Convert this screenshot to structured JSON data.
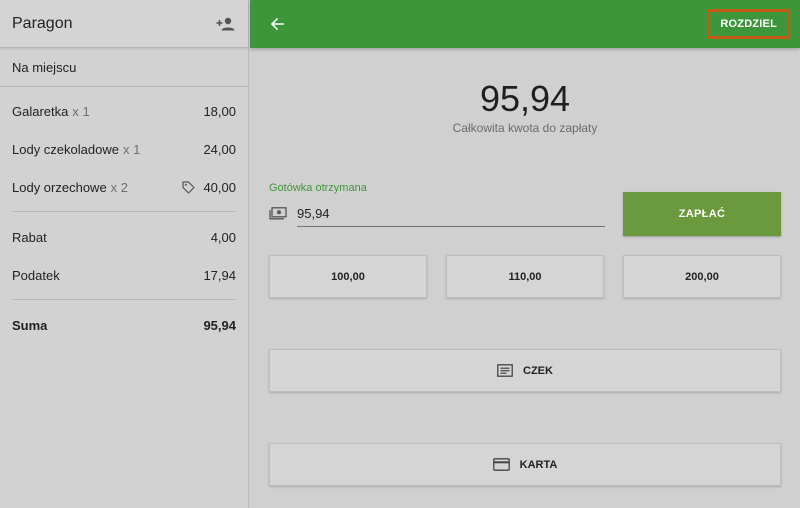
{
  "receipt": {
    "title": "Paragon",
    "add_customer_icon": "person-add-icon",
    "dine_option": "Na miejscu",
    "items": [
      {
        "name": "Galaretka",
        "qty": "x 1",
        "amount": "18,00",
        "has_tag": false
      },
      {
        "name": "Lody czekoladowe",
        "qty": "x 1",
        "amount": "24,00",
        "has_tag": false
      },
      {
        "name": "Lody orzechowe",
        "qty": "x 2",
        "amount": "40,00",
        "has_tag": true
      }
    ],
    "discount_label": "Rabat",
    "discount_value": "4,00",
    "tax_label": "Podatek",
    "tax_value": "17,94",
    "sum_label": "Suma",
    "sum_value": "95,94"
  },
  "topbar": {
    "back_icon": "arrow-back-icon",
    "split_label": "ROZDZIEL",
    "accent_color": "#3e963b",
    "highlight_color": "#c45a14"
  },
  "payment": {
    "total_amount": "95,94",
    "total_caption": "Całkowita kwota do zapłaty",
    "cash_label": "Gotówka otrzymana",
    "cash_icon": "cash-icon",
    "cash_value": "95,94",
    "pay_label": "ZAPŁAĆ",
    "quick_amounts": [
      "100,00",
      "110,00",
      "200,00"
    ],
    "check_label": "CZEK",
    "check_icon": "receipt-icon",
    "card_label": "KARTA",
    "card_icon": "credit-card-icon"
  }
}
